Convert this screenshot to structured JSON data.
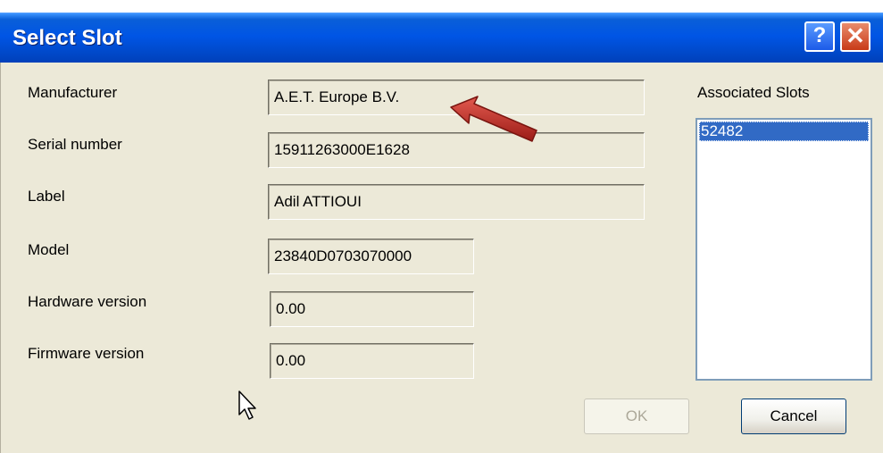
{
  "dialog": {
    "title": "Select Slot",
    "help_label": "?",
    "close_label": "✕"
  },
  "fields": {
    "manufacturer": {
      "label": "Manufacturer",
      "value": "A.E.T. Europe B.V."
    },
    "serial": {
      "label": "Serial number",
      "value": "15911263000E1628"
    },
    "label": {
      "label": "Label",
      "value": "Adil ATTIOUI"
    },
    "model": {
      "label": "Model",
      "value": "23840D0703070000"
    },
    "hardware": {
      "label": "Hardware version",
      "value": "0.00"
    },
    "firmware": {
      "label": "Firmware version",
      "value": "0.00"
    }
  },
  "slots": {
    "header": "Associated Slots",
    "items": [
      "52482"
    ],
    "selected_index": 0
  },
  "buttons": {
    "ok": "OK",
    "cancel": "Cancel"
  },
  "colors": {
    "titlebar": "#0055e5",
    "dialog_bg": "#ece9d8",
    "selection": "#316ac5",
    "annotation_arrow": "#b22222"
  }
}
